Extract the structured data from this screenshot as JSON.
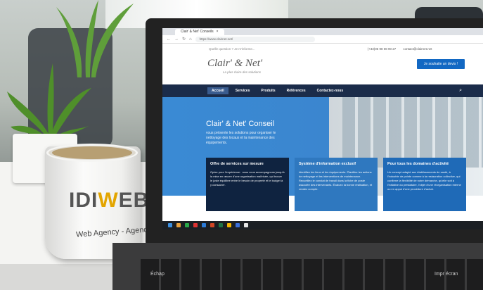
{
  "browser": {
    "tab_title": "Clair' & Net' Conseils",
    "url": "https://www.clairnet.net/"
  },
  "site": {
    "topbar_placeholder": "Quelle question ? Je m'informe...",
    "phone": "(+33)06 98 08 90 27",
    "email": "contact@clairnet.net",
    "logo": "Clair' & Net'",
    "tagline": "La plus claire des solutions",
    "cta_label": "Je souhaite un devis !",
    "menu": [
      "Accueil",
      "Services",
      "Produits",
      "Références",
      "Contactez-nous"
    ],
    "hero_title": "Clair' & Net' Conseil",
    "hero_text": "vous présente les solutions pour organiser le nettoyage des locaux et la maintenance des équipements.",
    "cards": [
      {
        "title": "Offre de services sur mesure",
        "text": "Optez pour l'expérience : nous vous accompagnons jusqu'à la mise en œuvre d'une organisation maîtrisée, qui trouve le juste équilibre entre le besoin de propreté et le budget à y consacrer."
      },
      {
        "title": "Système d'information exclusif",
        "text": "Identifiez les lieux et les équipements. Planifiez les actions de nettoyage et les interventions de maintenance. Recueillez le constat de travail dans la fiche de poste associée des intervenants. Évaluez la bonne réalisation, et rendez compte."
      },
      {
        "title": "Pour tous les domaines d'activité",
        "text": "Un concept adapté aux établissements de santé, à l'industrie de pointe comme à la restauration collective, qui confirme la flexibilité de notre démarche, qu'elle soit à l'initiative du prestataire, l'objet d'une réorganisation interne ou en appui d'une procédure d'achat."
      }
    ]
  },
  "mug": {
    "logo_left": "IDI",
    "logo_mid": "W",
    "logo_right": "EB",
    "tagline": "Web Agency - Agence Web"
  },
  "keyboard": {
    "key1": "Échap",
    "key2": "Impr écran"
  },
  "colors": {
    "navy": "#1b2c4a",
    "blue": "#1268c3",
    "mug_accent": "#e3a500"
  }
}
